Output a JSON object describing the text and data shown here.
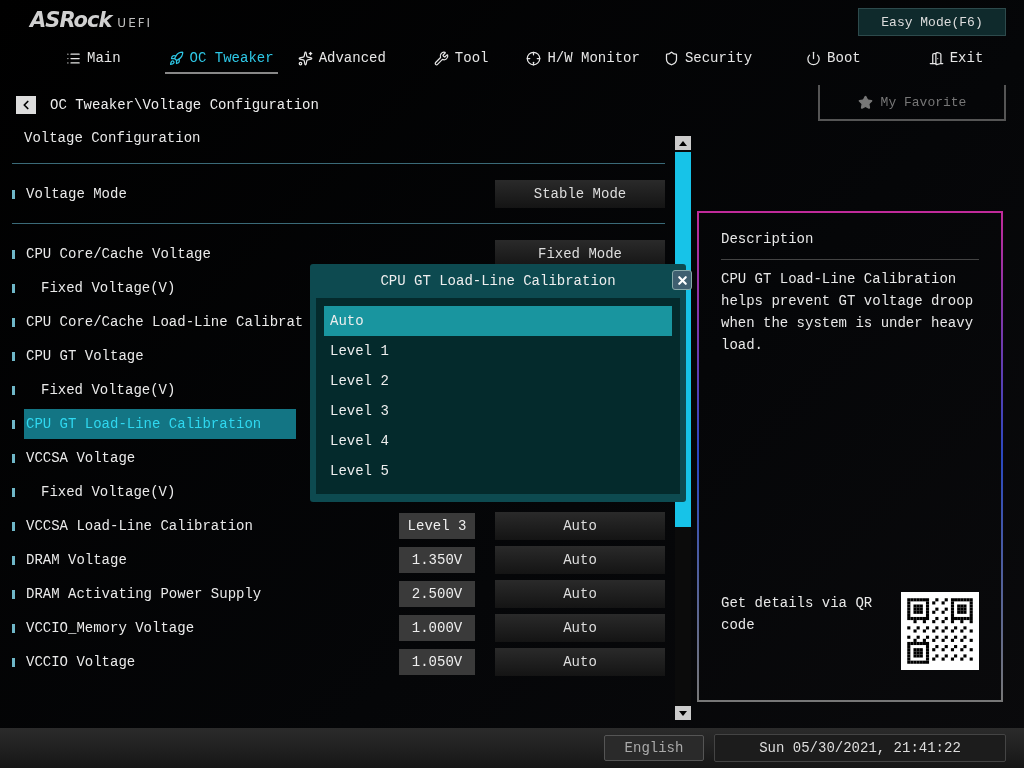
{
  "logo": {
    "brand": "ASRock",
    "suffix": "UEFI"
  },
  "easy_mode_button": "Easy Mode(F6)",
  "tabs": [
    {
      "label": "Main",
      "selected": false
    },
    {
      "label": "OC Tweaker",
      "selected": true
    },
    {
      "label": "Advanced",
      "selected": false
    },
    {
      "label": "Tool",
      "selected": false
    },
    {
      "label": "H/W Monitor",
      "selected": false
    },
    {
      "label": "Security",
      "selected": false
    },
    {
      "label": "Boot",
      "selected": false
    },
    {
      "label": "Exit",
      "selected": false
    }
  ],
  "breadcrumb": "OC Tweaker\\Voltage Configuration",
  "favorite_button": "My Favorite",
  "section_title": "Voltage Configuration",
  "voltage_mode": {
    "label": "Voltage Mode",
    "option": "Stable Mode"
  },
  "rows": [
    {
      "label": "CPU Core/Cache Voltage",
      "kind": "item",
      "selected": false,
      "option": "Fixed Mode"
    },
    {
      "label": "Fixed Voltage(V)",
      "kind": "sub",
      "selected": false
    },
    {
      "label": "CPU Core/Cache Load-Line Calibrat",
      "kind": "item",
      "selected": false
    },
    {
      "label": "CPU GT Voltage",
      "kind": "item",
      "selected": false
    },
    {
      "label": "Fixed Voltage(V)",
      "kind": "sub",
      "selected": false
    },
    {
      "label": "CPU GT Load-Line Calibration",
      "kind": "item",
      "selected": true
    },
    {
      "label": "VCCSA Voltage",
      "kind": "item",
      "selected": false
    },
    {
      "label": "Fixed Voltage(V)",
      "kind": "sub",
      "selected": false
    },
    {
      "label": "VCCSA Load-Line Calibration",
      "kind": "item",
      "selected": false,
      "current": "Level 3",
      "option": "Auto"
    },
    {
      "label": "DRAM Voltage",
      "kind": "item",
      "selected": false,
      "current": "1.350V",
      "option": "Auto"
    },
    {
      "label": "DRAM Activating Power Supply",
      "kind": "item",
      "selected": false,
      "current": "2.500V",
      "option": "Auto"
    },
    {
      "label": "VCCIO_Memory Voltage",
      "kind": "item",
      "selected": false,
      "current": "1.000V",
      "option": "Auto"
    },
    {
      "label": "VCCIO Voltage",
      "kind": "item",
      "selected": false,
      "current": "1.050V",
      "option": "Auto"
    }
  ],
  "popup": {
    "title": "CPU GT Load-Line Calibration",
    "options": [
      {
        "label": "Auto",
        "selected": true
      },
      {
        "label": "Level 1",
        "selected": false
      },
      {
        "label": "Level 2",
        "selected": false
      },
      {
        "label": "Level 3",
        "selected": false
      },
      {
        "label": "Level 4",
        "selected": false
      },
      {
        "label": "Level 5",
        "selected": false
      }
    ]
  },
  "description": {
    "title": "Description",
    "text": "CPU GT Load-Line Calibration helps prevent GT voltage droop when the system is under heavy load.",
    "qr_hint": "Get details via QR code"
  },
  "status_bar": {
    "language": "English",
    "datetime": "Sun 05/30/2021, 21:41:22"
  }
}
